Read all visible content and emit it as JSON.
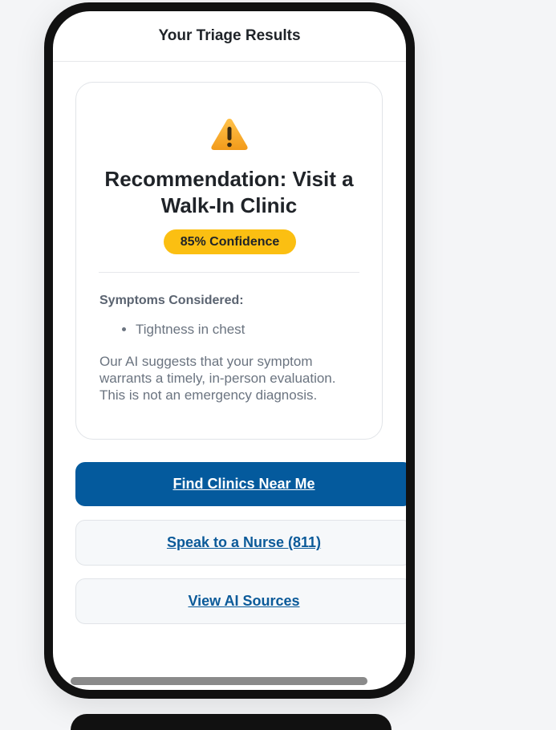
{
  "header": {
    "title": "Your Triage Results"
  },
  "card": {
    "icon": "warning-icon",
    "title": "Recommendation: Visit a Walk-In Clinic",
    "confidence_badge": "85% Confidence",
    "symptoms_heading": "Symptoms Considered:",
    "symptoms": [
      "Tightness in chest"
    ],
    "description": "Our AI suggests that your symptom warrants a timely, in-person evaluation. This is not an emergency diagnosis."
  },
  "actions": {
    "find_clinics": "Find Clinics Near Me",
    "speak_nurse": "Speak to a Nurse (811)",
    "view_sources": "View AI Sources"
  },
  "colors": {
    "primary": "#045a9d",
    "badge": "#fbbf12",
    "link": "#0b5a99"
  }
}
